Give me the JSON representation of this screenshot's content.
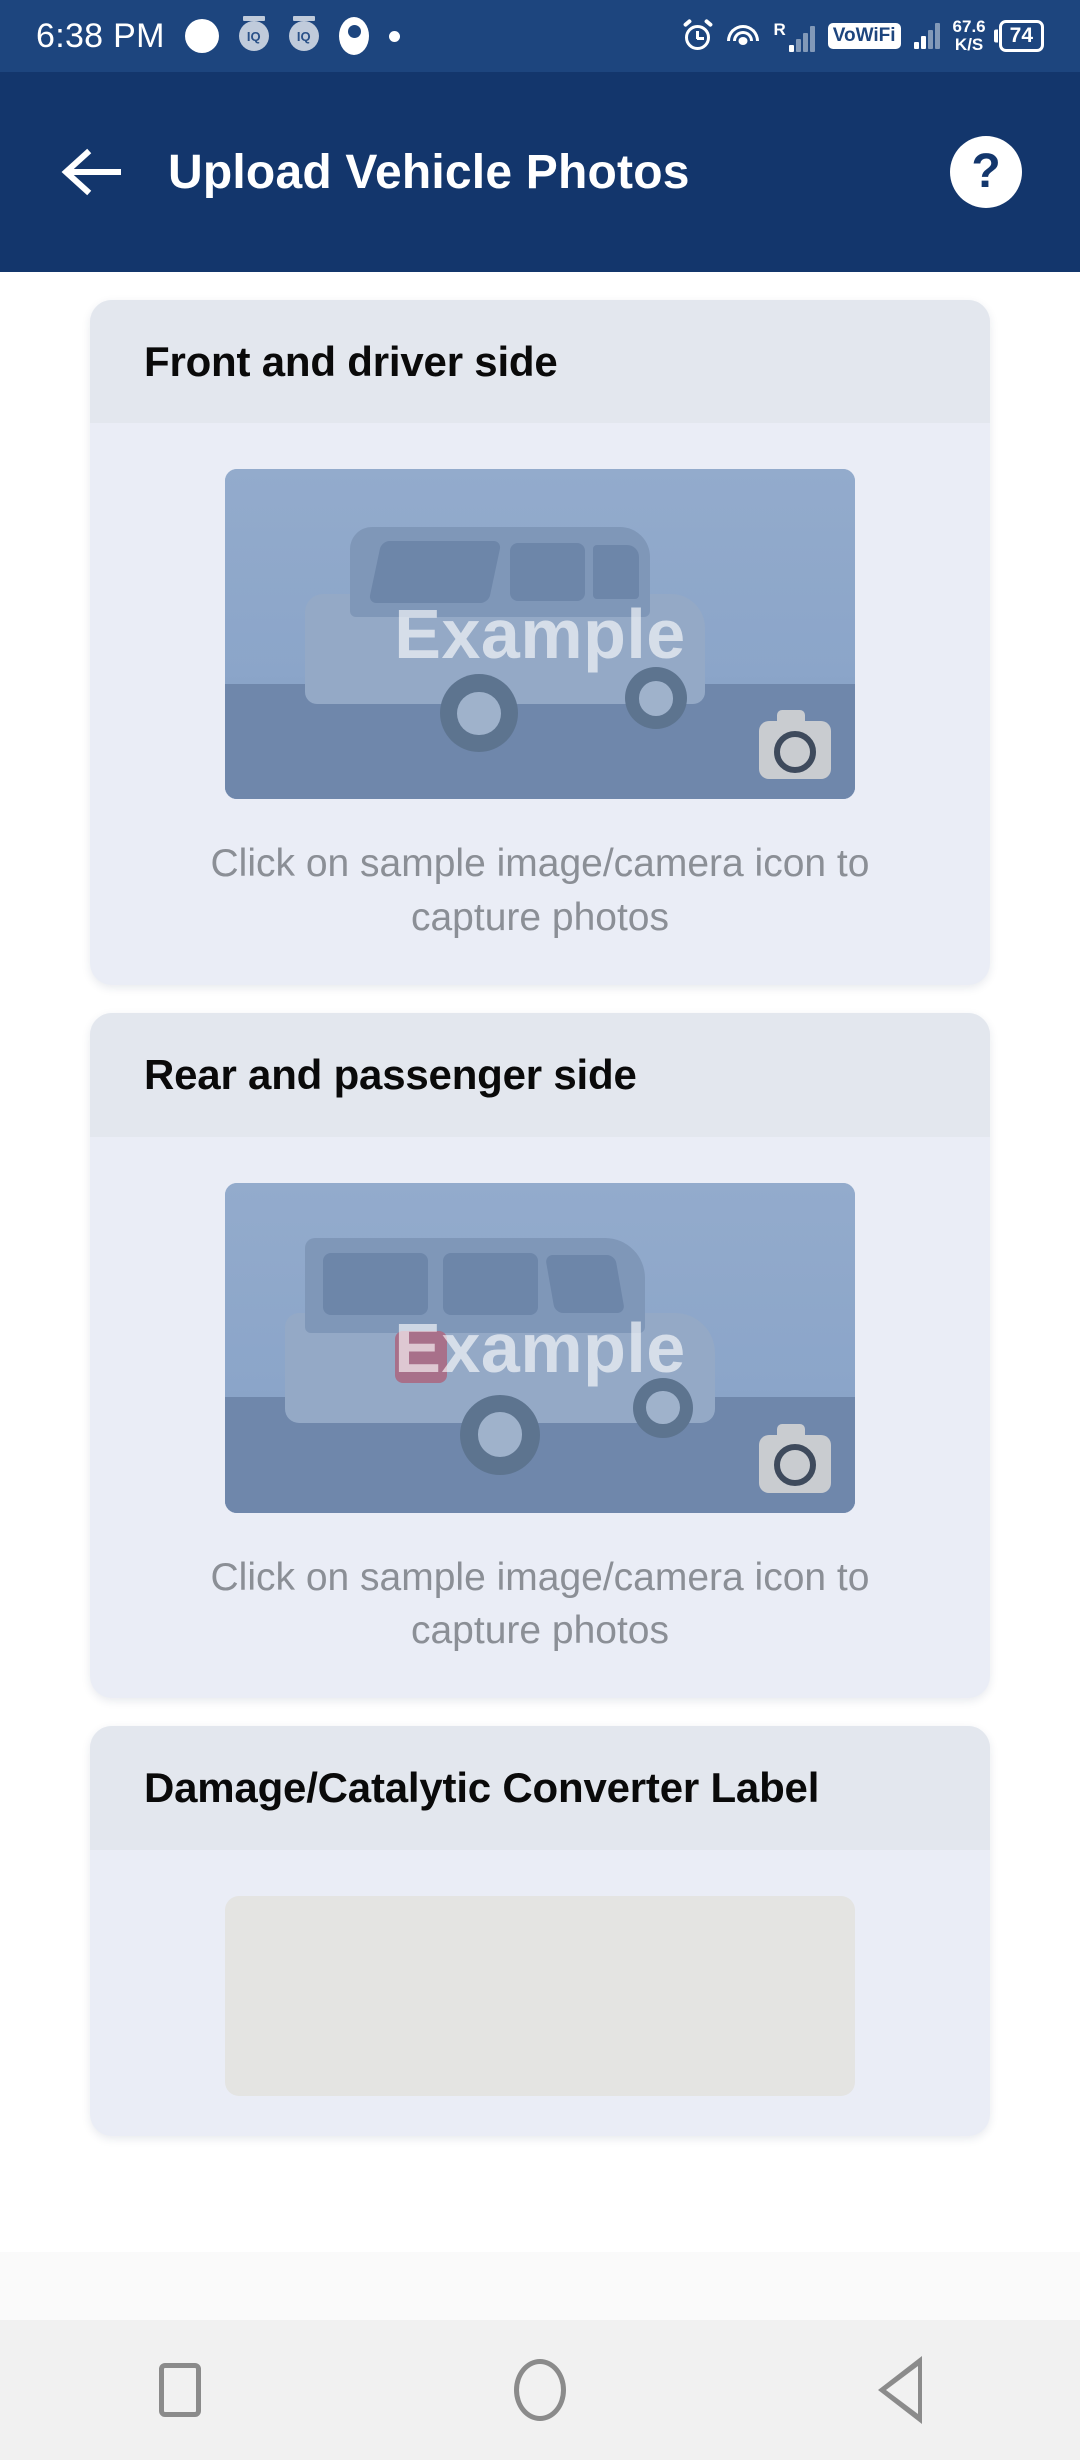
{
  "statusbar": {
    "time": "6:38 PM",
    "left_icons": [
      "white-circle-icon",
      "iq-graduation-icon",
      "iq-graduation-icon",
      "location-pin-icon",
      "small-dot-icon"
    ],
    "alarm_icon": "alarm-icon",
    "wifi_icon": "wifi-icon",
    "roaming_label": "R",
    "vowifi_label": "VoWiFi",
    "net_speed_value": "67.6",
    "net_speed_unit": "K/S",
    "battery_level": "74"
  },
  "appbar": {
    "back_icon": "back-arrow-icon",
    "title": "Upload Vehicle Photos",
    "help_icon": "help-question-icon",
    "help_label": "?"
  },
  "colors": {
    "statusbar_bg": "#1d457e",
    "appbar_bg": "#13366c",
    "page_bg": "#ffffff",
    "card_bg": "#eaedf6",
    "card_header_bg": "#e3e7ee",
    "sample_tint": "#8aa4c8",
    "hint_text": "#8b8f96",
    "navbar_bg": "#f1f1f1"
  },
  "cards": [
    {
      "title": "Front and driver side",
      "sample": {
        "watermark": "Example",
        "camera_icon": "camera-icon",
        "view": "front-driver-side"
      },
      "hint": "Click on sample image/camera icon to capture photos"
    },
    {
      "title": "Rear and passenger side",
      "sample": {
        "watermark": "Example",
        "camera_icon": "camera-icon",
        "view": "rear-passenger-side"
      },
      "hint": "Click on sample image/camera icon to capture photos"
    },
    {
      "title": "Damage/Catalytic Converter Label",
      "sample": null,
      "hint": ""
    }
  ],
  "navbar": {
    "recents_icon": "square-recents-icon",
    "home_icon": "circle-home-icon",
    "back_icon": "triangle-back-icon"
  }
}
